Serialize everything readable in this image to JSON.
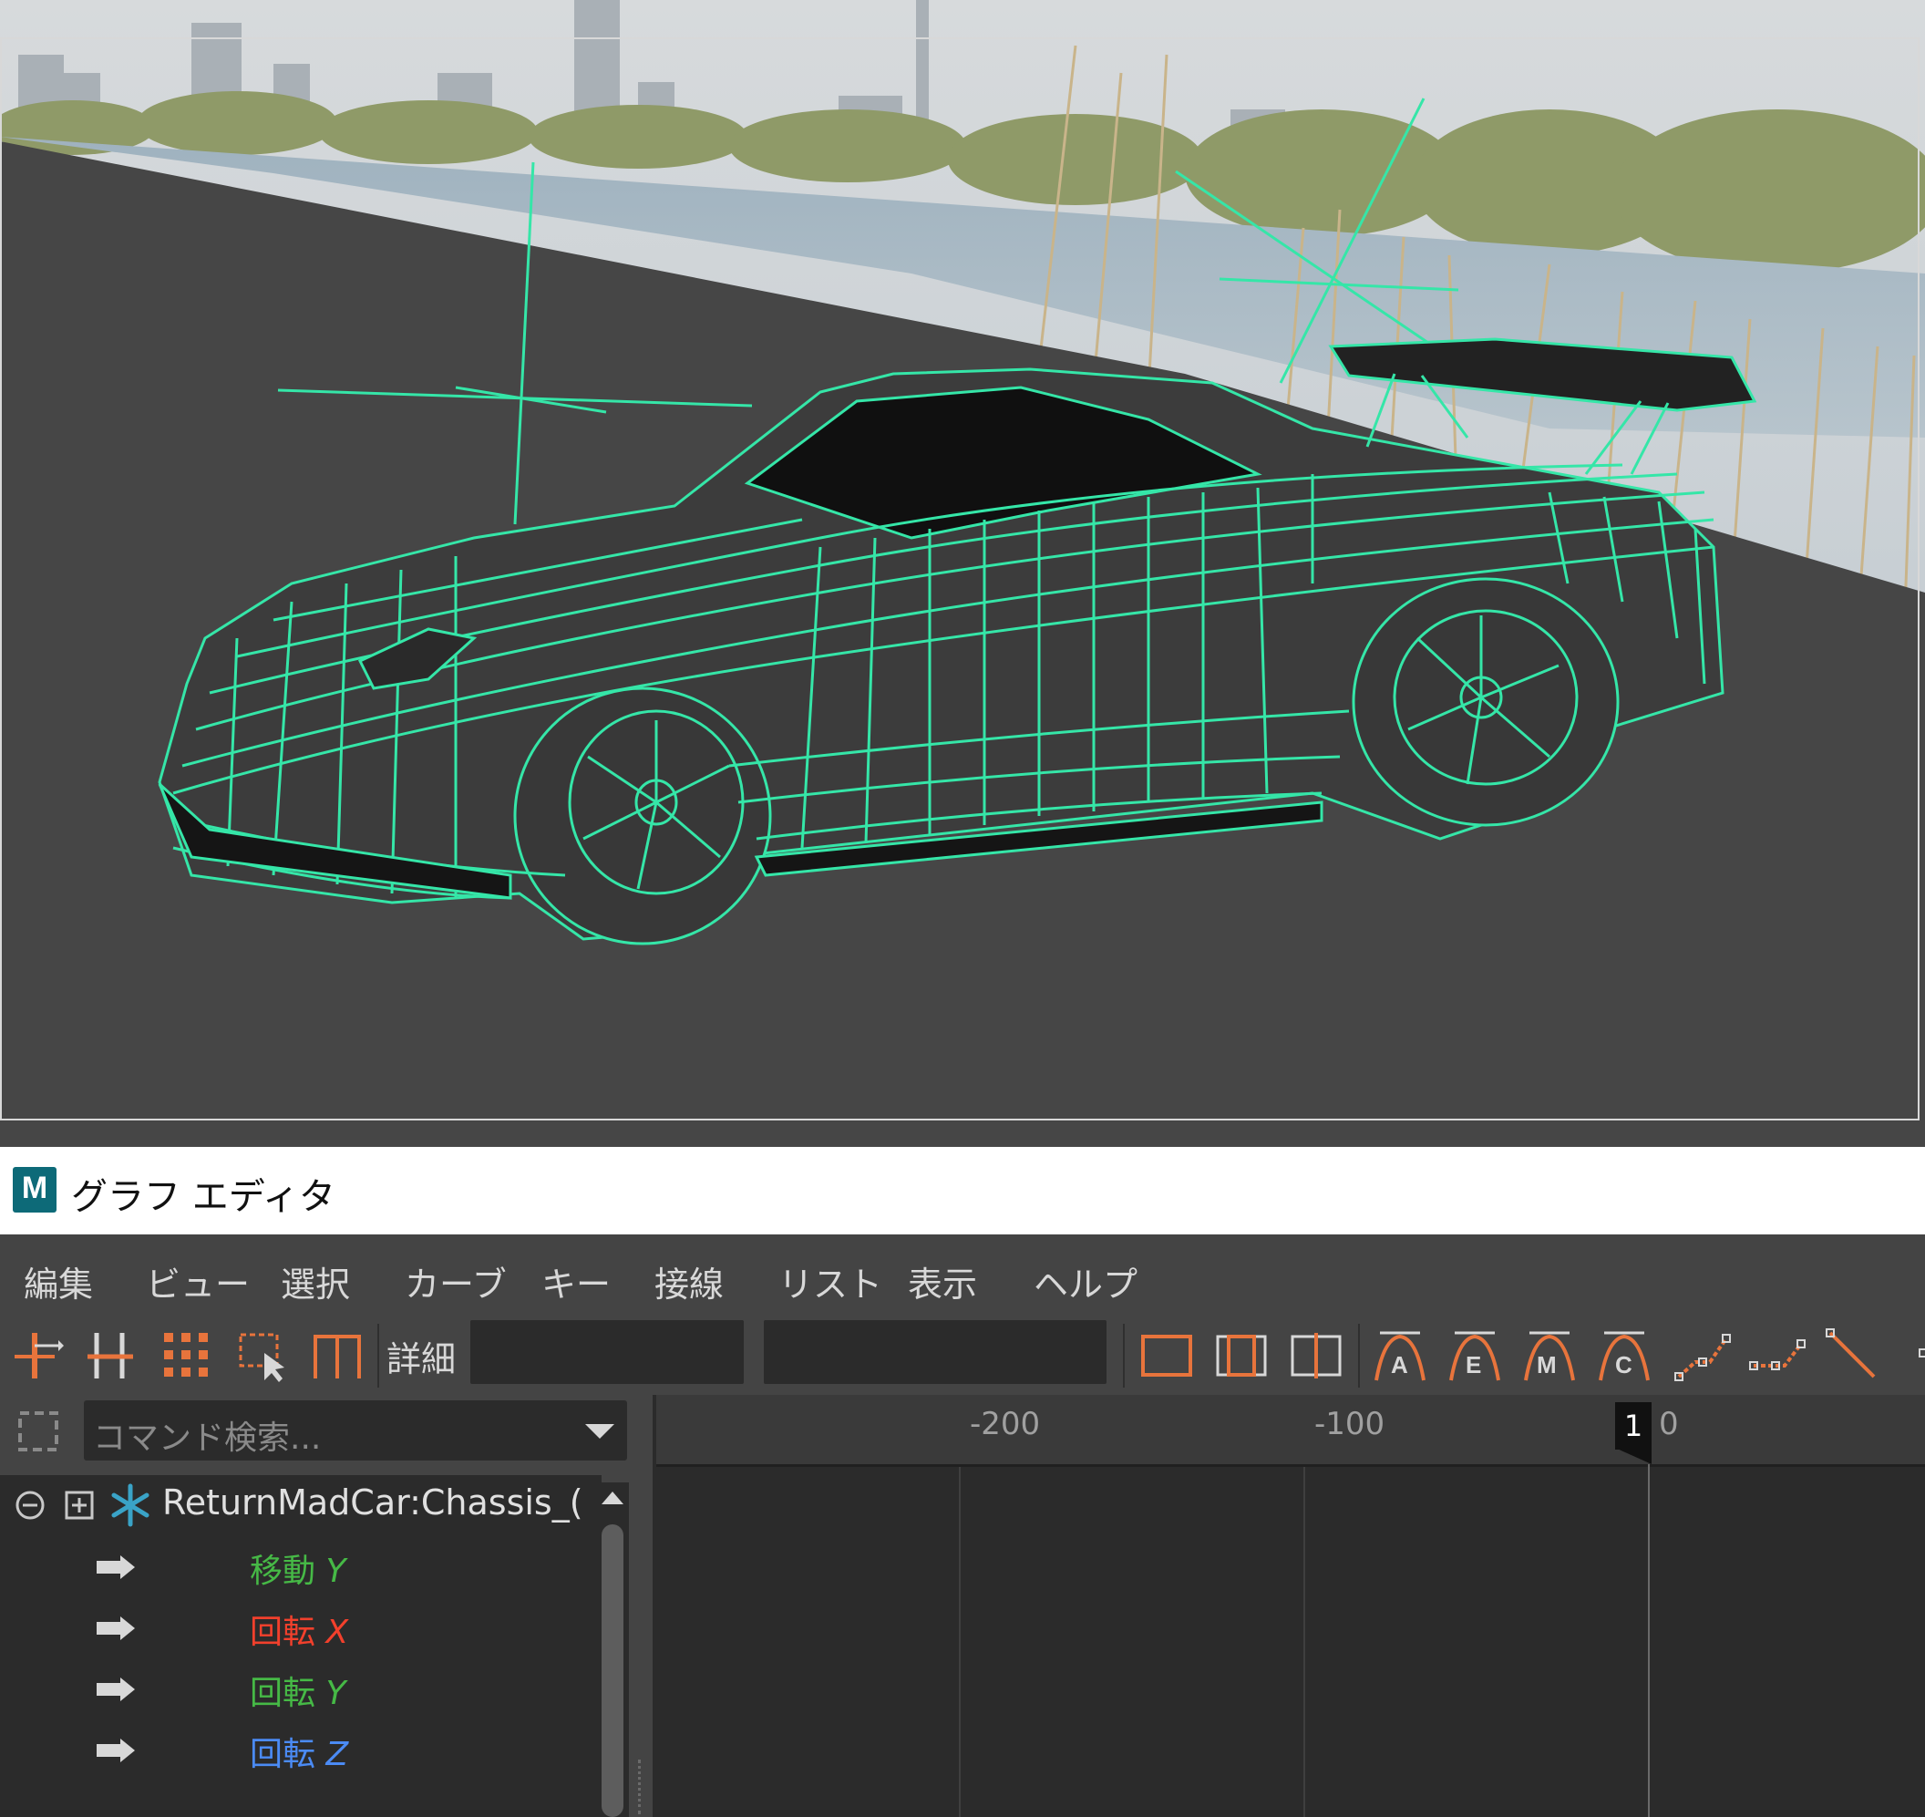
{
  "viewport": {
    "wire_color": "#35e6a8",
    "bg_sky": "#c9cfd3",
    "ground": "#464646"
  },
  "graph_editor": {
    "title": "グラフ エディタ",
    "logo_letter": "M"
  },
  "menubar": {
    "items": [
      "編集",
      "ビュー",
      "選択",
      "カーブ",
      "キー",
      "接線",
      "リスト",
      "表示",
      "ヘルプ"
    ]
  },
  "toolbar": {
    "detail_label": "詳細",
    "field1_value": "",
    "field2_value": "",
    "accent": "#e8743c",
    "tangent_letters": [
      "A",
      "E",
      "M",
      "C"
    ]
  },
  "outliner": {
    "search_placeholder": "コマンド検索...",
    "node_name": "ReturnMadCar:Chassis_(",
    "attributes": [
      {
        "name": "移動",
        "axis": "Y",
        "color": "#46b946"
      },
      {
        "name": "回転",
        "axis": "X",
        "color": "#f2402c"
      },
      {
        "name": "回転",
        "axis": "Y",
        "color": "#46b946"
      },
      {
        "name": "回転",
        "axis": "Z",
        "color": "#4b8bf5"
      }
    ]
  },
  "graph": {
    "ticks": [
      "-200",
      "-100",
      "0"
    ],
    "current_frame": "1"
  }
}
